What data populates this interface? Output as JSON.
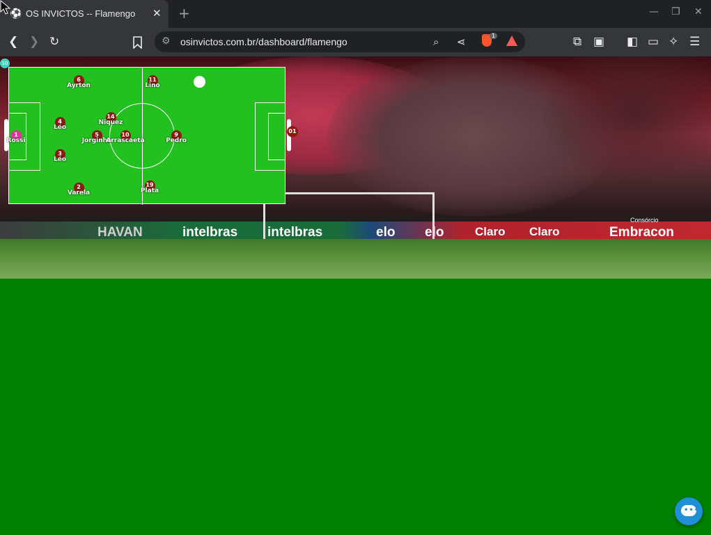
{
  "browser": {
    "tab_title": "OS INVICTOS -- Flamengo",
    "tab_icon": "soccer-ball-icon",
    "close_tab": "✕",
    "new_tab": "+",
    "url": "osinvictos.com.br/dashboard/flamengo",
    "brave_shield_count": "1",
    "window_controls": [
      "—",
      "❐",
      "✕"
    ]
  },
  "hero": {
    "ads": [
      "HAVAN",
      "intelbras",
      "intelbras",
      "elo",
      "elo",
      "Claro",
      "Claro",
      "Embracon"
    ],
    "ad_small": "Consórcio"
  },
  "pitch": {
    "players": [
      {
        "number": "1",
        "name": "Rossi",
        "role": "gk"
      },
      {
        "number": "6",
        "name": "Ayrton"
      },
      {
        "number": "4",
        "name": "Léo"
      },
      {
        "number": "3",
        "name": "Léo"
      },
      {
        "number": "2",
        "name": "Varela"
      },
      {
        "number": "14",
        "name": "Niquez"
      },
      {
        "number": "5",
        "name": "Jorginho"
      },
      {
        "number": "10",
        "name": "Arrascaeta"
      },
      {
        "number": "11",
        "name": "Lino"
      },
      {
        "number": "9",
        "name": "Pedro"
      },
      {
        "number": "19",
        "name": "Plata"
      }
    ],
    "minute_badge": "01",
    "corner_badge": "10"
  },
  "chat": {
    "icon": "chat-bubble-icon"
  }
}
